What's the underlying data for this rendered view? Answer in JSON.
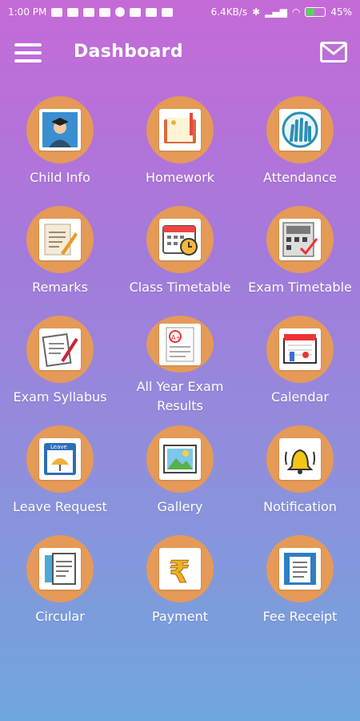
{
  "status": {
    "time": "1:00 PM",
    "network": "6.4KB/s",
    "battery": "45%",
    "battery_level": 0.45
  },
  "header": {
    "title": "Dashboard"
  },
  "tiles": [
    {
      "label": "Child Info",
      "icon": "student-icon"
    },
    {
      "label": "Homework",
      "icon": "homework-icon"
    },
    {
      "label": "Attendance",
      "icon": "attendance-icon"
    },
    {
      "label": "Remarks",
      "icon": "remarks-icon"
    },
    {
      "label": "Class Timetable",
      "icon": "timetable-icon"
    },
    {
      "label": "Exam Timetable",
      "icon": "exam-timetable-icon"
    },
    {
      "label": "Exam Syllabus",
      "icon": "syllabus-icon"
    },
    {
      "label": "All Year Exam Results",
      "icon": "results-icon"
    },
    {
      "label": "Calendar",
      "icon": "calendar-icon"
    },
    {
      "label": "Leave Request",
      "icon": "leave-icon"
    },
    {
      "label": "Gallery",
      "icon": "gallery-icon"
    },
    {
      "label": "Notification",
      "icon": "bell-icon"
    },
    {
      "label": "Circular",
      "icon": "circular-icon"
    },
    {
      "label": "Payment",
      "icon": "rupee-icon"
    },
    {
      "label": "Fee Receipt",
      "icon": "receipt-icon"
    }
  ]
}
